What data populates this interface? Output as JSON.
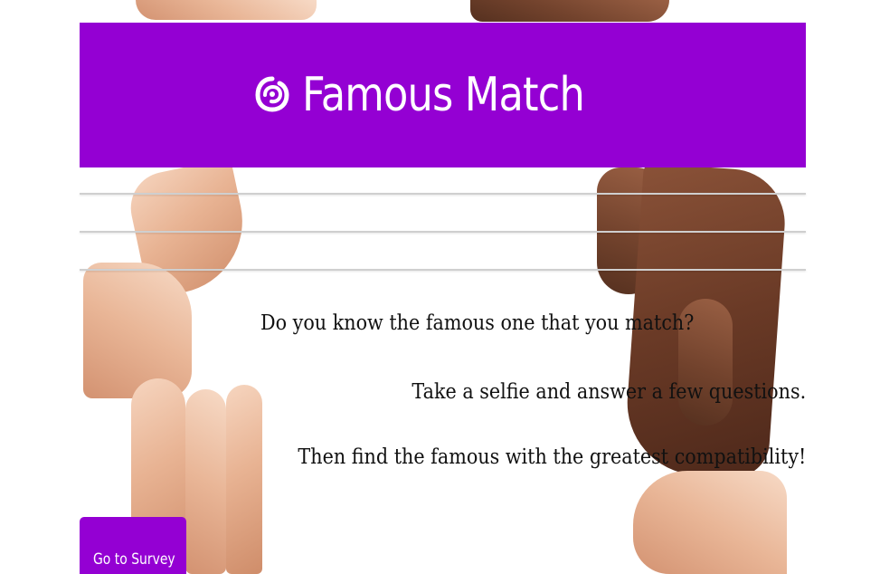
{
  "header": {
    "title": "Famous Match",
    "logo_icon": "eye-swirl-icon",
    "background_color": "#9400d3"
  },
  "content": {
    "line_1": "Do you know the famous one that you match?",
    "line_2": "Take a selfie and answer a few questions.",
    "line_3": "Then find the famous with the greatest compatibility!"
  },
  "survey_button": {
    "label": "Go to Survey",
    "icon": "document-list-icon"
  },
  "background_image": "hands-framing-photo"
}
